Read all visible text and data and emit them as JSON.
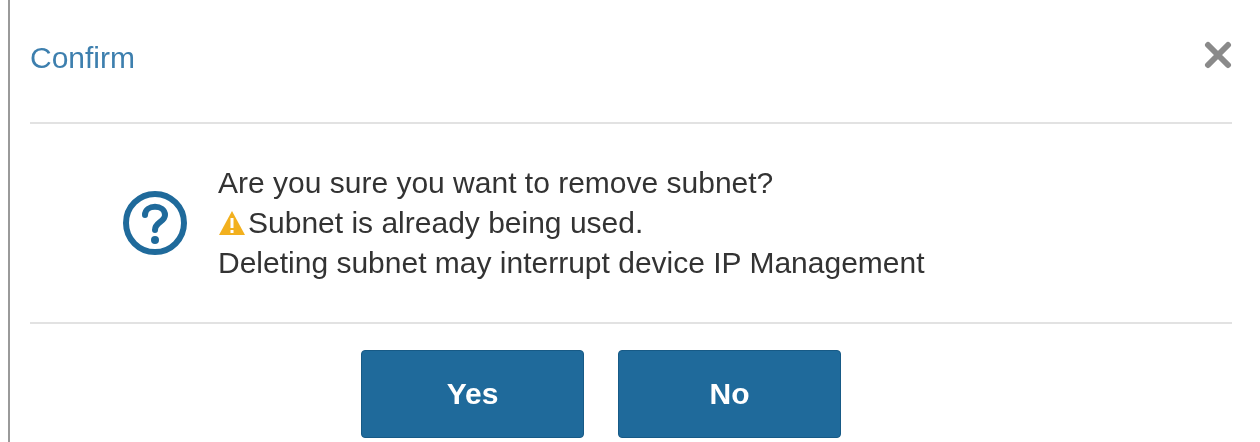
{
  "dialog": {
    "title": "Confirm",
    "message": {
      "question": "Are you sure you want to remove subnet?",
      "warning": "Subnet is already being used.",
      "detail": "Deleting subnet may interrupt device IP Management"
    },
    "buttons": [
      {
        "label": "Yes"
      },
      {
        "label": "No"
      }
    ]
  }
}
